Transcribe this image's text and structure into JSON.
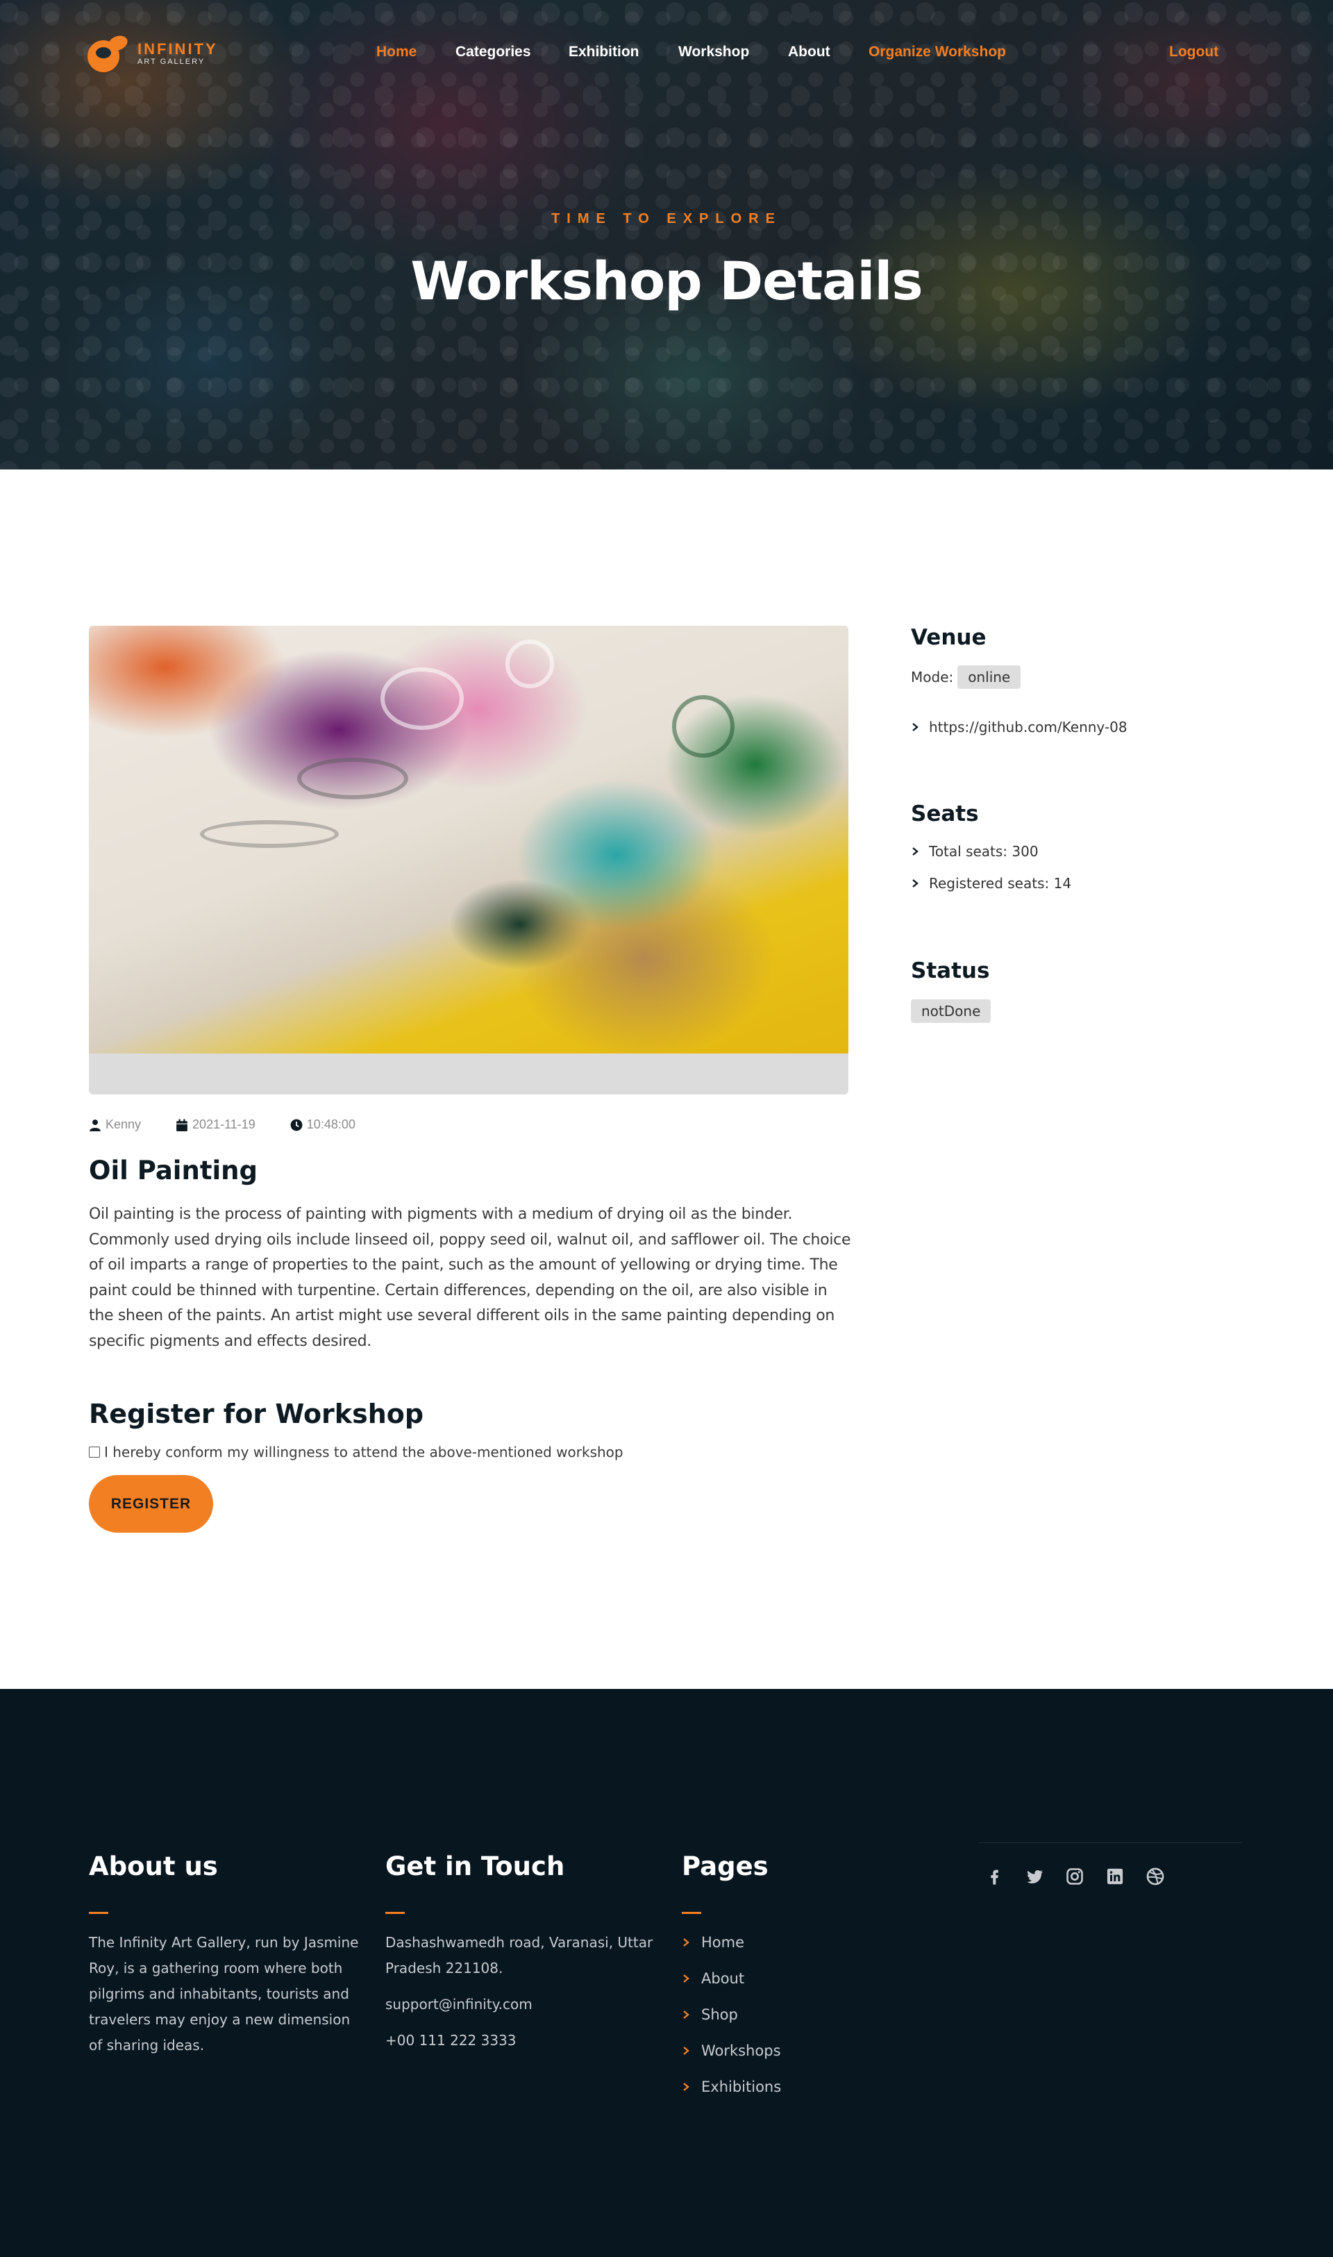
{
  "brand": {
    "name": "INFINITY",
    "tagline": "ART GALLERY"
  },
  "nav": {
    "home": "Home",
    "categories": "Categories",
    "exhibition": "Exhibition",
    "workshop": "Workshop",
    "about": "About",
    "organize": "Organize Workshop",
    "logout": "Logout"
  },
  "hero": {
    "subtitle": "TIME TO EXPLORE",
    "title": "Workshop Details"
  },
  "post": {
    "author": "Kenny",
    "date": "2021-11-19",
    "time": "10:48:00",
    "title": "Oil Painting",
    "body": "Oil painting is the process of painting with pigments with a medium of drying oil as the binder. Commonly used drying oils include linseed oil, poppy seed oil, walnut oil, and safflower oil. The choice of oil imparts a range of properties to the paint, such as the amount of yellowing or drying time. The paint could be thinned with turpentine. Certain differences, depending on the oil, are also visible in the sheen of the paints. An artist might use several different oils in the same painting depending on specific pigments and effects desired."
  },
  "register": {
    "title": "Register for Workshop",
    "checkbox_label": "I hereby conform my willingness to attend the above-mentioned workshop",
    "button": "REGISTER"
  },
  "venue": {
    "heading": "Venue",
    "mode_label": "Mode:",
    "mode_value": "online",
    "link": "https://github.com/Kenny-08"
  },
  "seats": {
    "heading": "Seats",
    "total": "Total seats: 300",
    "registered": "Registered seats: 14"
  },
  "status": {
    "heading": "Status",
    "value": "notDone"
  },
  "footer": {
    "about_heading": "About us",
    "about_text": "The Infinity Art Gallery, run by Jasmine Roy, is a gathering room where both pilgrims and inhabitants, tourists and travelers may enjoy a new dimension of sharing ideas.",
    "contact_heading": "Get in Touch",
    "address": "Dashashwamedh road, Varanasi, Uttar Pradesh 221108.",
    "email": "support@infinity.com",
    "phone": "+00 111 222 3333",
    "pages_heading": "Pages",
    "pages": [
      "Home",
      "About",
      "Shop",
      "Workshops",
      "Exhibitions"
    ]
  },
  "colors": {
    "accent": "#f37f23",
    "footer_bg": "#081620",
    "heading": "#0e1a22"
  },
  "icons": {
    "meta": [
      "user-icon",
      "calendar-icon",
      "clock-icon"
    ],
    "social": [
      "facebook-icon",
      "twitter-icon",
      "instagram-icon",
      "linkedin-icon",
      "dribbble-icon"
    ]
  }
}
